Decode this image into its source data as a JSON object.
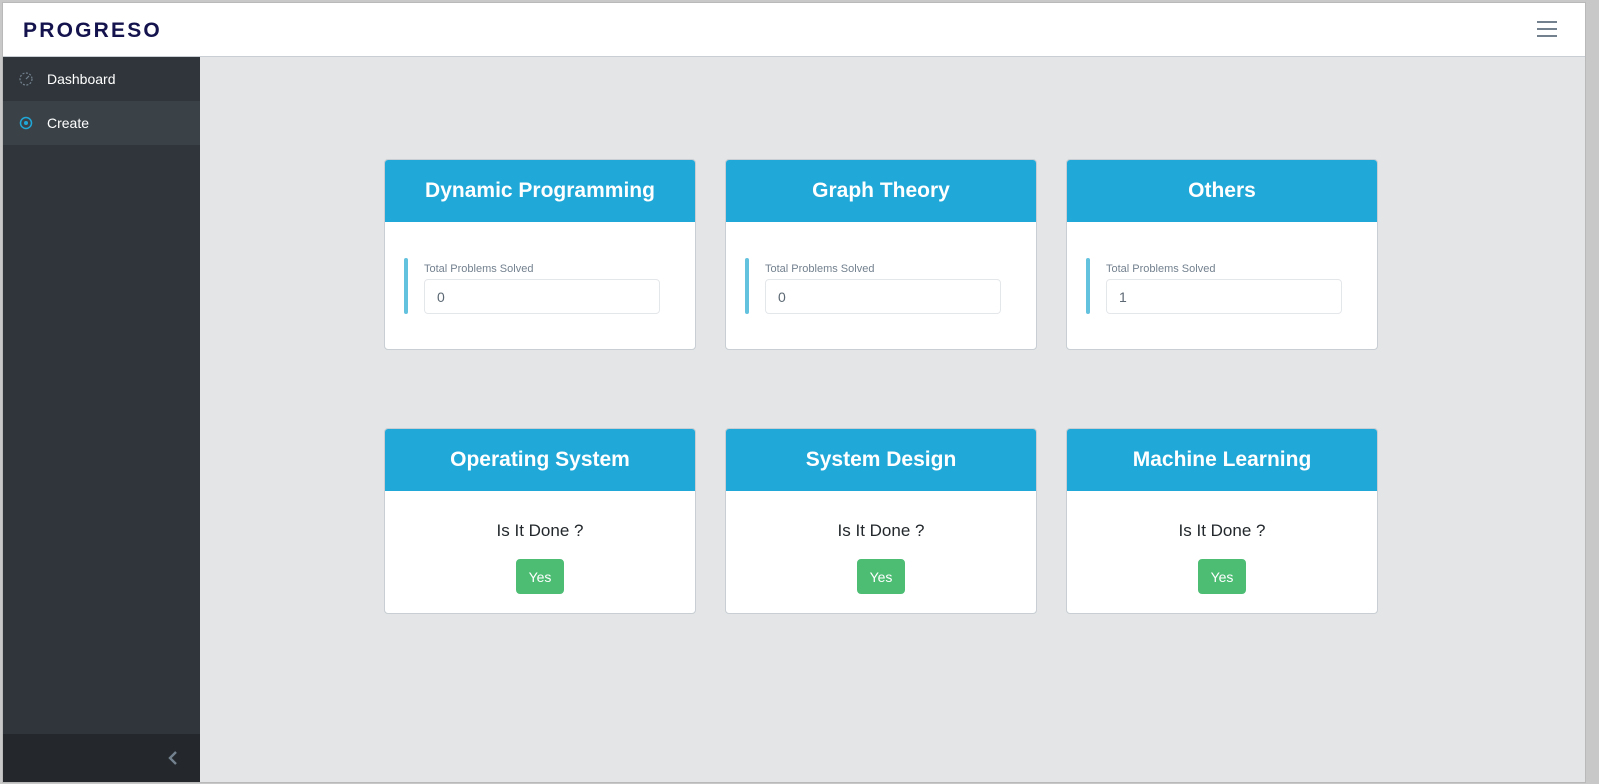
{
  "app": {
    "brand": "PROGRESO"
  },
  "sidebar": {
    "items": [
      {
        "label": "Dashboard",
        "icon": "speedometer-icon"
      },
      {
        "label": "Create",
        "icon": "target-icon",
        "active": true
      }
    ]
  },
  "cards_top": [
    {
      "title": "Dynamic Programming",
      "field_label": "Total Problems Solved",
      "value": "0"
    },
    {
      "title": "Graph Theory",
      "field_label": "Total Problems Solved",
      "value": "0"
    },
    {
      "title": "Others",
      "field_label": "Total Problems Solved",
      "value": "1"
    }
  ],
  "cards_bottom": [
    {
      "title": "Operating System",
      "question": "Is It Done ?",
      "button": "Yes"
    },
    {
      "title": "System Design",
      "question": "Is It Done ?",
      "button": "Yes"
    },
    {
      "title": "Machine Learning",
      "question": "Is It Done ?",
      "button": "Yes"
    }
  ],
  "colors": {
    "header_accent": "#20a8d8",
    "sidebar_bg": "#2f353a",
    "success": "#4dbd74",
    "callout": "#63c2de"
  }
}
